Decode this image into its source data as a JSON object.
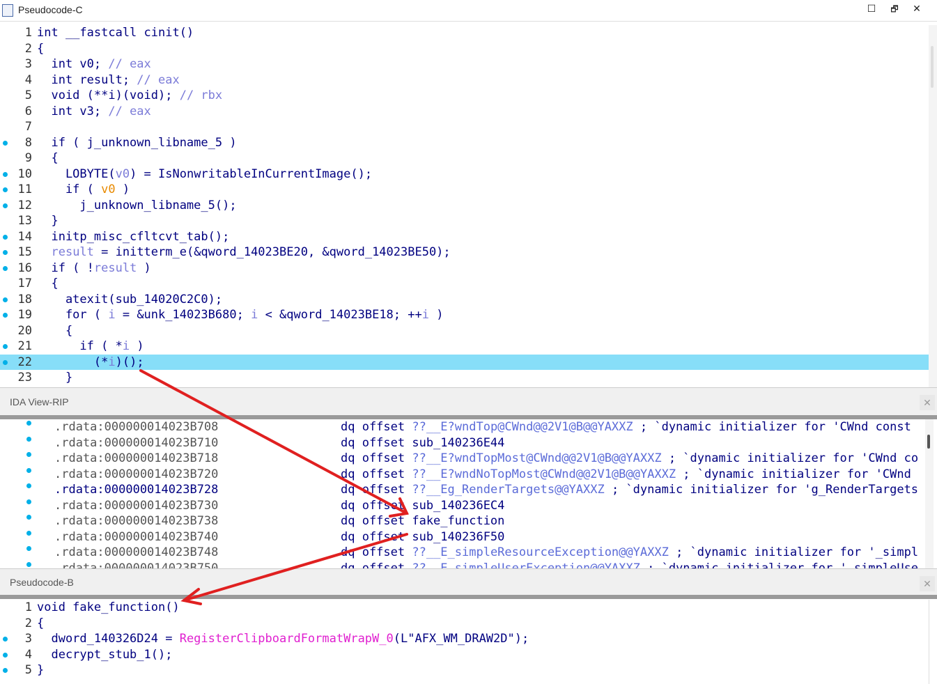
{
  "pseudocode_c": {
    "title": "Pseudocode-C",
    "lines": [
      {
        "n": "1",
        "dot": false,
        "html": "int __fastcall cinit()"
      },
      {
        "n": "2",
        "dot": false,
        "html": "{"
      },
      {
        "n": "3",
        "dot": false,
        "html": "  int v0; <span class='cm'>// eax</span>"
      },
      {
        "n": "4",
        "dot": false,
        "html": "  int result; <span class='cm'>// eax</span>"
      },
      {
        "n": "5",
        "dot": false,
        "html": "  void (**i)(void); <span class='cm'>// rbx</span>"
      },
      {
        "n": "6",
        "dot": false,
        "html": "  int v3; <span class='cm'>// eax</span>"
      },
      {
        "n": "7",
        "dot": false,
        "html": ""
      },
      {
        "n": "8",
        "dot": true,
        "html": "  if ( j_unknown_libname_5 )"
      },
      {
        "n": "9",
        "dot": false,
        "html": "  {"
      },
      {
        "n": "10",
        "dot": true,
        "html": "    LOBYTE(<span class='vr'>v0</span>) = IsNonwritableInCurrentImage();"
      },
      {
        "n": "11",
        "dot": true,
        "html": "    if ( <span class='or'>v0</span> )"
      },
      {
        "n": "12",
        "dot": true,
        "html": "      j_unknown_libname_5();"
      },
      {
        "n": "13",
        "dot": false,
        "html": "  }"
      },
      {
        "n": "14",
        "dot": true,
        "html": "  initp_misc_cfltcvt_tab();"
      },
      {
        "n": "15",
        "dot": true,
        "html": "  <span class='vr'>result</span> = initterm_e(&amp;qword_14023BE20, &amp;qword_14023BE50);"
      },
      {
        "n": "16",
        "dot": true,
        "html": "  if ( !<span class='vr'>result</span> )"
      },
      {
        "n": "17",
        "dot": false,
        "html": "  {"
      },
      {
        "n": "18",
        "dot": true,
        "html": "    atexit(sub_14020C2C0);"
      },
      {
        "n": "19",
        "dot": true,
        "html": "    for ( <span class='vr'>i</span> = &amp;unk_14023B680; <span class='vr'>i</span> &lt; &amp;qword_14023BE18; ++<span class='vr'>i</span> )"
      },
      {
        "n": "20",
        "dot": false,
        "html": "    {"
      },
      {
        "n": "21",
        "dot": true,
        "html": "      if ( *<span class='vr'>i</span> )"
      },
      {
        "n": "22",
        "dot": true,
        "hl": true,
        "html": "        (*<span class='vr'>i</span>)();"
      },
      {
        "n": "23",
        "dot": false,
        "html": "    }"
      }
    ]
  },
  "ida_view": {
    "title": "IDA View-RIP",
    "rows": [
      {
        "addr": ".rdata:000000014023B708",
        "html": "dq offset <span class='ida-sym'>??__E?wndTop@CWnd@@2V1@B@@YAXXZ</span> ; `dynamic initializer for 'CWnd const"
      },
      {
        "addr": ".rdata:000000014023B710",
        "html": "dq offset sub_140236E44"
      },
      {
        "addr": ".rdata:000000014023B718",
        "html": "dq offset <span class='ida-sym'>??__E?wndTopMost@CWnd@@2V1@B@@YAXXZ</span> ; `dynamic initializer for 'CWnd co"
      },
      {
        "addr": ".rdata:000000014023B720",
        "html": "dq offset <span class='ida-sym'>??__E?wndNoTopMost@CWnd@@2V1@B@@YAXXZ</span> ; `dynamic initializer for 'CWnd"
      },
      {
        "addr": ".rdata:000000014023B728",
        "dark": true,
        "html": "dq offset <span class='ida-sym'>??__Eg_RenderTargets@@YAXXZ</span> ; `dynamic initializer for 'g_RenderTargets"
      },
      {
        "addr": ".rdata:000000014023B730",
        "html": "dq offset sub_140236EC4"
      },
      {
        "addr": ".rdata:000000014023B738",
        "html": "dq offset fake_function"
      },
      {
        "addr": ".rdata:000000014023B740",
        "html": "dq offset sub_140236F50"
      },
      {
        "addr": ".rdata:000000014023B748",
        "html": "dq offset <span class='ida-sym'>??__E_simpleResourceException@@YAXXZ</span> ; `dynamic initializer for '_simpl"
      },
      {
        "addr": ".rdata:000000014023B750",
        "html": "dq offset <span class='ida-sym'>??__E_simpleUserException@@YAXXZ</span> ; `dynamic initializer for '_simpleUse"
      }
    ]
  },
  "pseudocode_b": {
    "title": "Pseudocode-B",
    "lines": [
      {
        "n": "1",
        "dot": false,
        "html": "void fake_function()"
      },
      {
        "n": "2",
        "dot": false,
        "html": "{"
      },
      {
        "n": "3",
        "dot": true,
        "html": "  dword_140326D24 = <span class='mg'>RegisterClipboardFormatWrapW_0</span>(L\"AFX_WM_DRAW2D\");"
      },
      {
        "n": "4",
        "dot": true,
        "html": "  decrypt_stub_1();"
      },
      {
        "n": "5",
        "dot": true,
        "html": "}"
      }
    ]
  },
  "window_buttons": {
    "maximize": "☐",
    "restore": "🗗",
    "close": "✕",
    "view_close": "✕"
  },
  "arrow_color": "#e02020"
}
